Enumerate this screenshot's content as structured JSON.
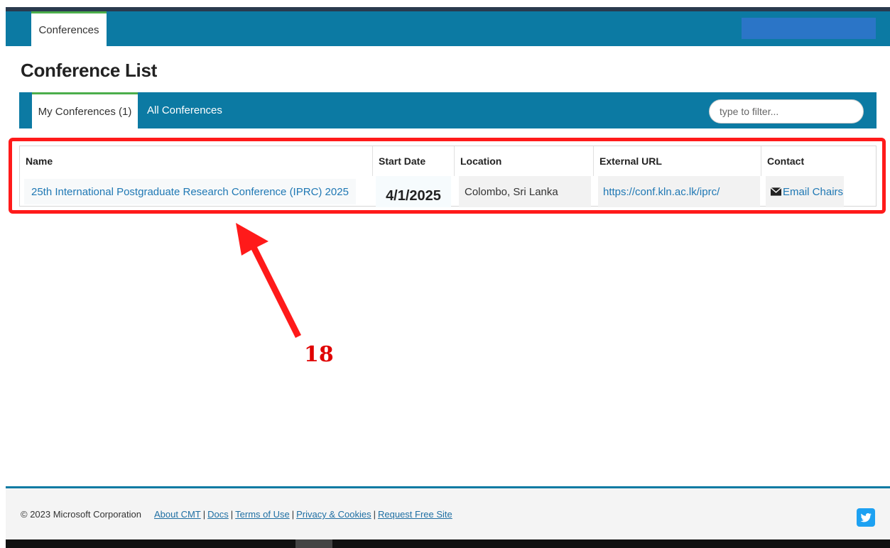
{
  "topnav": {
    "tab_label": "Conferences"
  },
  "page": {
    "title": "Conference List"
  },
  "tabs": {
    "my_conferences": "My Conferences (1)",
    "all_conferences": "All Conferences",
    "filter_placeholder": "type to filter..."
  },
  "table": {
    "headers": {
      "name": "Name",
      "start_date": "Start Date",
      "location": "Location",
      "external_url": "External URL",
      "contact": "Contact"
    },
    "rows": [
      {
        "name": "25th International Postgraduate Research Conference (IPRC) 2025",
        "start_date": "4/1/2025",
        "location": "Colombo, Sri Lanka",
        "external_url": "https://conf.kln.ac.lk/iprc/",
        "contact": "Email Chairs"
      }
    ]
  },
  "annotation": {
    "number": "18",
    "color": "#ff1a1a"
  },
  "footer": {
    "copyright": "© 2023 Microsoft Corporation",
    "links": [
      "About CMT",
      "Docs",
      "Terms of Use",
      "Privacy & Cookies",
      "Request Free Site"
    ],
    "social_icon": "twitter-icon"
  },
  "colors": {
    "nav": "#0c7aa3",
    "accent": "#4cae4c",
    "link": "#1f78b4"
  }
}
